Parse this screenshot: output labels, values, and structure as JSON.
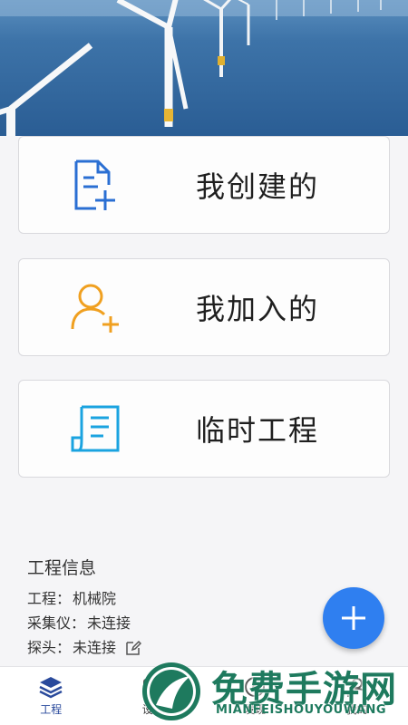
{
  "cards": [
    {
      "label": "我创建的",
      "icon": "document-add-icon"
    },
    {
      "label": "我加入的",
      "icon": "user-add-icon"
    },
    {
      "label": "临时工程",
      "icon": "temp-file-icon"
    }
  ],
  "info": {
    "title": "工程信息",
    "project_label": "工程：",
    "project_value": "机械院",
    "collector_label": "采集仪：",
    "collector_value": "未连接",
    "probe_label": "探头：",
    "probe_value": "未连接"
  },
  "fab": {
    "icon": "plus-icon"
  },
  "tabs": [
    {
      "label": "工程",
      "icon": "layers-icon",
      "active": true
    },
    {
      "label": "设备",
      "icon": "device-icon",
      "active": false
    },
    {
      "label": "发现",
      "icon": "compass-icon",
      "active": false
    },
    {
      "label": "我的",
      "icon": "user-icon",
      "active": false
    }
  ],
  "watermark": {
    "text": "免费手游网",
    "sub": "MIANFEISHOUYOUWANG"
  },
  "colors": {
    "accent": "#2f7ff0",
    "tab_active": "#2a4a9c",
    "icon_blue": "#2a6fd3",
    "icon_orange": "#f0a020",
    "icon_cyan": "#1aa3e0"
  }
}
